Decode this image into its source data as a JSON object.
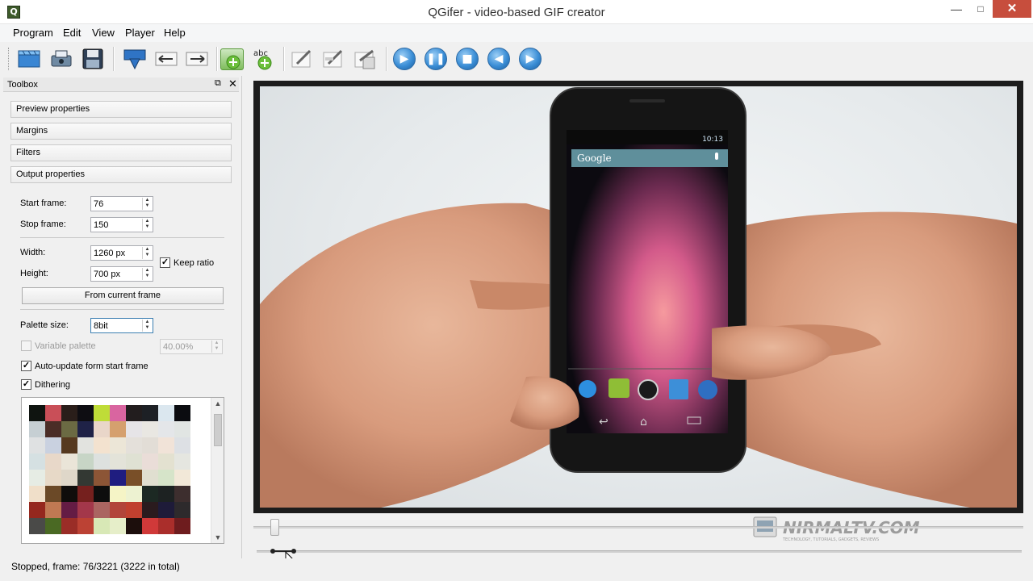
{
  "window": {
    "title": "QGifer - video-based GIF creator",
    "app_icon": "Q"
  },
  "menu": {
    "items": [
      "Program",
      "Edit",
      "View",
      "Player",
      "Help"
    ]
  },
  "toolbar": {
    "icons": [
      "open-video-icon",
      "extract-gif-icon",
      "save-gif-icon",
      "set-frames-icon",
      "set-start-icon",
      "set-stop-icon",
      "add-object-icon",
      "add-text-icon",
      "edit-object-icon",
      "edit-text-icon",
      "remove-object-icon",
      "play-icon",
      "pause-icon",
      "stop-icon",
      "previous-icon",
      "next-icon"
    ]
  },
  "toolbox": {
    "title": "Toolbox",
    "sections": [
      "Preview properties",
      "Margins",
      "Filters",
      "Output properties"
    ],
    "start_frame": {
      "label": "Start frame:",
      "value": "76"
    },
    "stop_frame": {
      "label": "Stop frame:",
      "value": "150"
    },
    "width": {
      "label": "Width:",
      "value": "1260 px"
    },
    "height": {
      "label": "Height:",
      "value": "700 px"
    },
    "keep_ratio": {
      "label": "Keep ratio",
      "checked": true
    },
    "from_current_frame": "From current frame",
    "palette_size": {
      "label": "Palette size:",
      "value": "8bit"
    },
    "variable_palette": {
      "label": "Variable palette",
      "value": "40.00%",
      "checked": false,
      "enabled": false
    },
    "auto_update": {
      "label": "Auto-update form start frame",
      "checked": true
    },
    "dithering": {
      "label": "Dithering",
      "checked": true
    },
    "palette_colors": [
      "#0f1410",
      "#c94f58",
      "#2a1e1a",
      "#0e0d12",
      "#bfdc38",
      "#d965a0",
      "#221d1e",
      "#1d2025",
      "#dbe7ef",
      "#0b0c10",
      "#c6cfd3",
      "#4a2d27",
      "#6b6a43",
      "#1f2247",
      "#e9d6c9",
      "#d5a06e",
      "#e6e4e7",
      "#e9e7e2",
      "#e4e6e9",
      "#e1e5e3",
      "#dfe1e2",
      "#c9d1e0",
      "#56391f",
      "#e2e3df",
      "#f3e2cf",
      "#ece6d7",
      "#e4e0da",
      "#e2ddd6",
      "#f1e3d8",
      "#dde0e4",
      "#d5e0e2",
      "#e8d8c9",
      "#eae5d8",
      "#c7d5c6",
      "#dde1df",
      "#e3e3d9",
      "#dfe1d3",
      "#eaddd8",
      "#e3e1d0",
      "#e5e6e0",
      "#e6ece4",
      "#e7d9c7",
      "#dfd7c9",
      "#333833",
      "#8c5536",
      "#1f1d80",
      "#794f28",
      "#e0dfd0",
      "#d6e4c9",
      "#f2e8d8",
      "#f0dfc9",
      "#6b4927",
      "#0f0d0b",
      "#75201e",
      "#0d0d0d",
      "#f5f4c6",
      "#edf2d1",
      "#1c2923",
      "#1d2222",
      "#3d2e2e",
      "#95281e",
      "#c07953",
      "#641c44",
      "#a3374a",
      "#aa6561",
      "#b2443a",
      "#c0402f",
      "#2a1b1e",
      "#1e1b39",
      "#2d2a2c",
      "#4a4a48",
      "#4a6923",
      "#9a2d27",
      "#bc4234",
      "#d8e8b6",
      "#e6eec9",
      "#1c0e0c",
      "#d03939",
      "#aa2e2b",
      "#6e1c1e"
    ]
  },
  "status": "Stopped, frame: 76/3221 (3222 in total)",
  "watermark": {
    "text": "NIRMALTV.COM",
    "tagline": "TECHNOLOGY, TUTORIALS, GADGETS, REVIEWS"
  },
  "phone": {
    "time": "10:13",
    "search": "Google"
  },
  "playback": {
    "position_fraction": 0.024,
    "range_start_fraction": 0.076,
    "range_end_fraction": 0.15
  }
}
